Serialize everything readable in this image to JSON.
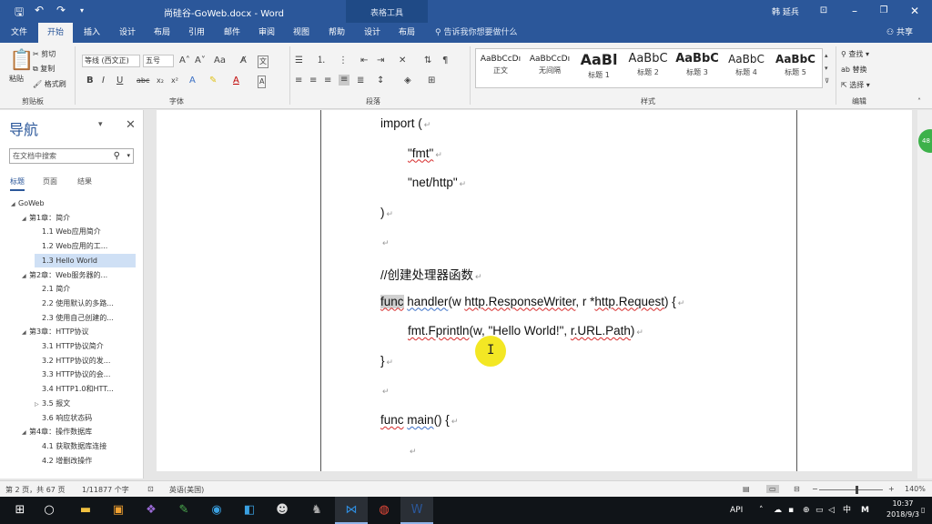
{
  "titlebar": {
    "doc_title": "尚硅谷-GoWeb.docx - Word",
    "context_tab": "表格工具",
    "user": "韩 延兵",
    "icons": [
      "save-icon",
      "undo-icon",
      "redo-icon",
      "customize-icon"
    ]
  },
  "tabs": [
    "文件",
    "开始",
    "插入",
    "设计",
    "布局",
    "引用",
    "邮件",
    "审阅",
    "视图",
    "帮助",
    "设计",
    "布局"
  ],
  "active_tab_index": 1,
  "tellme": "告诉我你想要做什么",
  "share": "共享",
  "ribbon": {
    "clipboard": {
      "paste": "粘贴",
      "cut": "剪切",
      "copy": "复制",
      "format_painter": "格式刷",
      "label": "剪贴板"
    },
    "font": {
      "name": "等线 (西文正)",
      "size": "五号",
      "label": "字体",
      "bold": "B",
      "italic": "I",
      "underline": "U",
      "strike": "abc",
      "sub": "x₂",
      "sup": "x²"
    },
    "paragraph": {
      "label": "段落"
    },
    "styles": {
      "label": "样式",
      "items": [
        {
          "preview": "AaBbCcDı",
          "name": "正文"
        },
        {
          "preview": "AaBbCcDı",
          "name": "无间隔"
        },
        {
          "preview": "AaBl",
          "name": "标题 1"
        },
        {
          "preview": "AaBbC",
          "name": "标题 2"
        },
        {
          "preview": "AaBbC",
          "name": "标题 3"
        },
        {
          "preview": "AaBbC",
          "name": "标题 4"
        },
        {
          "preview": "AaBbC",
          "name": "标题 5"
        }
      ]
    },
    "editing": {
      "find": "查找",
      "replace": "替换",
      "select": "选择",
      "label": "编辑"
    }
  },
  "nav": {
    "title": "导航",
    "search_placeholder": "在文档中搜索",
    "tabs": [
      "标题",
      "页面",
      "结果"
    ],
    "tree": [
      {
        "label": "GoWeb",
        "level": 0,
        "expand": "open"
      },
      {
        "label": "第1章：简介",
        "level": 1,
        "expand": "open"
      },
      {
        "label": "1.1 Web应用简介",
        "level": 2,
        "expand": ""
      },
      {
        "label": "1.2 Web应用的工...",
        "level": 2,
        "expand": ""
      },
      {
        "label": "1.3 Hello World",
        "level": 2,
        "expand": "",
        "selected": true
      },
      {
        "label": "第2章：Web服务器的...",
        "level": 1,
        "expand": "open"
      },
      {
        "label": "2.1 简介",
        "level": 2,
        "expand": ""
      },
      {
        "label": "2.2 使用默认的多路...",
        "level": 2,
        "expand": ""
      },
      {
        "label": "2.3 使用自己创建的...",
        "level": 2,
        "expand": ""
      },
      {
        "label": "第3章：HTTP协议",
        "level": 1,
        "expand": "open"
      },
      {
        "label": "3.1 HTTP协议简介",
        "level": 2,
        "expand": ""
      },
      {
        "label": "3.2 HTTP协议的发...",
        "level": 2,
        "expand": ""
      },
      {
        "label": "3.3 HTTP协议的会...",
        "level": 2,
        "expand": ""
      },
      {
        "label": "3.4 HTTP1.0和HTT...",
        "level": 2,
        "expand": ""
      },
      {
        "label": "3.5 报文",
        "level": 2,
        "expand": "closed"
      },
      {
        "label": "3.6 响应状态码",
        "level": 2,
        "expand": ""
      },
      {
        "label": "第4章：操作数据库",
        "level": 1,
        "expand": "open"
      },
      {
        "label": "4.1 获取数据库连接",
        "level": 2,
        "expand": ""
      },
      {
        "label": "4.2 增删改操作",
        "level": 2,
        "expand": ""
      }
    ]
  },
  "document": {
    "lines": [
      {
        "parts": [
          {
            "t": "import (",
            "s": ""
          }
        ],
        "indent": 0
      },
      {
        "parts": [
          {
            "t": "\"fmt\"",
            "s": "red"
          }
        ],
        "indent": 1
      },
      {
        "parts": [
          {
            "t": "\"net/http\"",
            "s": ""
          }
        ],
        "indent": 1
      },
      {
        "parts": [
          {
            "t": ")",
            "s": ""
          }
        ],
        "indent": 0
      },
      {
        "parts": [
          {
            "t": "",
            "s": ""
          }
        ],
        "indent": 0
      },
      {
        "parts": [
          {
            "t": "//创建处理器函数",
            "s": ""
          }
        ],
        "indent": 0
      },
      {
        "parts": [
          {
            "t": "func",
            "s": "hlred"
          },
          {
            "t": " ",
            "s": ""
          },
          {
            "t": "handler",
            "s": "blue"
          },
          {
            "t": "(w ",
            "s": ""
          },
          {
            "t": "http.ResponseWriter",
            "s": "red"
          },
          {
            "t": ", r *",
            "s": ""
          },
          {
            "t": "http.Request",
            "s": "red"
          },
          {
            "t": ") {",
            "s": ""
          }
        ],
        "indent": 0
      },
      {
        "parts": [
          {
            "t": "fmt.Fprintln",
            "s": "red"
          },
          {
            "t": "(w, \"Hello World!\", ",
            "s": ""
          },
          {
            "t": "r.URL.Path",
            "s": "red"
          },
          {
            "t": ")",
            "s": ""
          }
        ],
        "indent": 1
      },
      {
        "parts": [
          {
            "t": "}",
            "s": ""
          }
        ],
        "indent": 0
      },
      {
        "parts": [
          {
            "t": "",
            "s": ""
          }
        ],
        "indent": 0
      },
      {
        "parts": [
          {
            "t": "func",
            "s": "red"
          },
          {
            "t": " ",
            "s": ""
          },
          {
            "t": "main",
            "s": "blue"
          },
          {
            "t": "() {",
            "s": ""
          }
        ],
        "indent": 0
      },
      {
        "parts": [
          {
            "t": "",
            "s": ""
          }
        ],
        "indent": 1
      }
    ],
    "para_mark": "↵"
  },
  "status": {
    "page": "第 2 页，共 67 页",
    "words": "1/11877 个字",
    "lang": "英语(美国)",
    "zoom": "140%",
    "zoom_level": 140
  },
  "taskbar": {
    "tray_api": "API",
    "ime": "中",
    "ime2": "M",
    "time": "10:37",
    "date": "2018/9/3"
  },
  "colors": {
    "accent": "#2b579a",
    "spell": "#d62b2b",
    "grammar": "#3b6fc7",
    "highlight": "#f2e40c"
  }
}
